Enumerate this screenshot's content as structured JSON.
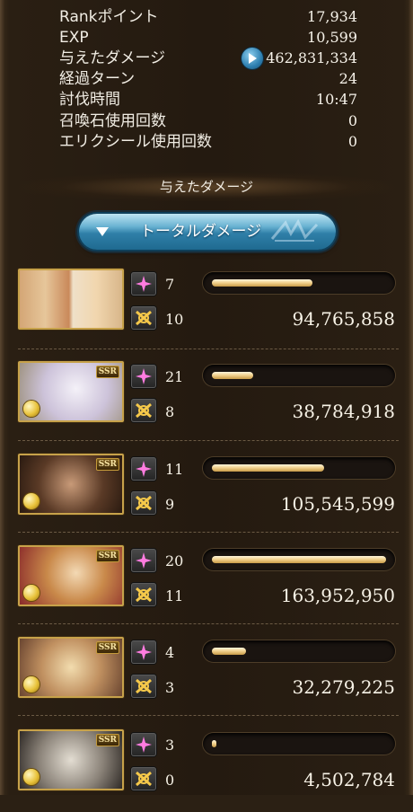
{
  "stats": [
    {
      "label": "Rankポイント",
      "value": "17,934"
    },
    {
      "label": "EXP",
      "value": "10,599"
    },
    {
      "label": "与えたダメージ",
      "value": "462,831,334"
    },
    {
      "label": "経過ターン",
      "value": "24"
    },
    {
      "label": "討伐時間",
      "value": "10:47"
    },
    {
      "label": "召喚石使用回数",
      "value": "0"
    },
    {
      "label": "エリクシール使用回数",
      "value": "0"
    }
  ],
  "section_title": "与えたダメージ",
  "total_button_label": "トータルダメージ",
  "badge_text": "SSR",
  "characters": [
    {
      "ability_uses": "7",
      "ca_uses": "10",
      "damage": "94,765,858",
      "damage_ratio": 0.578,
      "colors": [
        "#e8c9a3",
        "#c9895a"
      ]
    },
    {
      "ability_uses": "21",
      "ca_uses": "8",
      "damage": "38,784,918",
      "damage_ratio": 0.237,
      "colors": [
        "#e9e4ef",
        "#b7a9c4"
      ]
    },
    {
      "ability_uses": "11",
      "ca_uses": "9",
      "damage": "105,545,599",
      "damage_ratio": 0.644,
      "colors": [
        "#6a4a32",
        "#3a2618"
      ]
    },
    {
      "ability_uses": "20",
      "ca_uses": "11",
      "damage": "163,952,950",
      "damage_ratio": 1.0,
      "colors": [
        "#e9c9a0",
        "#b0453a"
      ]
    },
    {
      "ability_uses": "4",
      "ca_uses": "3",
      "damage": "32,279,225",
      "damage_ratio": 0.197,
      "colors": [
        "#e7cf9a",
        "#8a5a3a"
      ]
    },
    {
      "ability_uses": "3",
      "ca_uses": "0",
      "damage": "4,502,784",
      "damage_ratio": 0.027,
      "colors": [
        "#d8d2c8",
        "#5a5048"
      ]
    }
  ]
}
